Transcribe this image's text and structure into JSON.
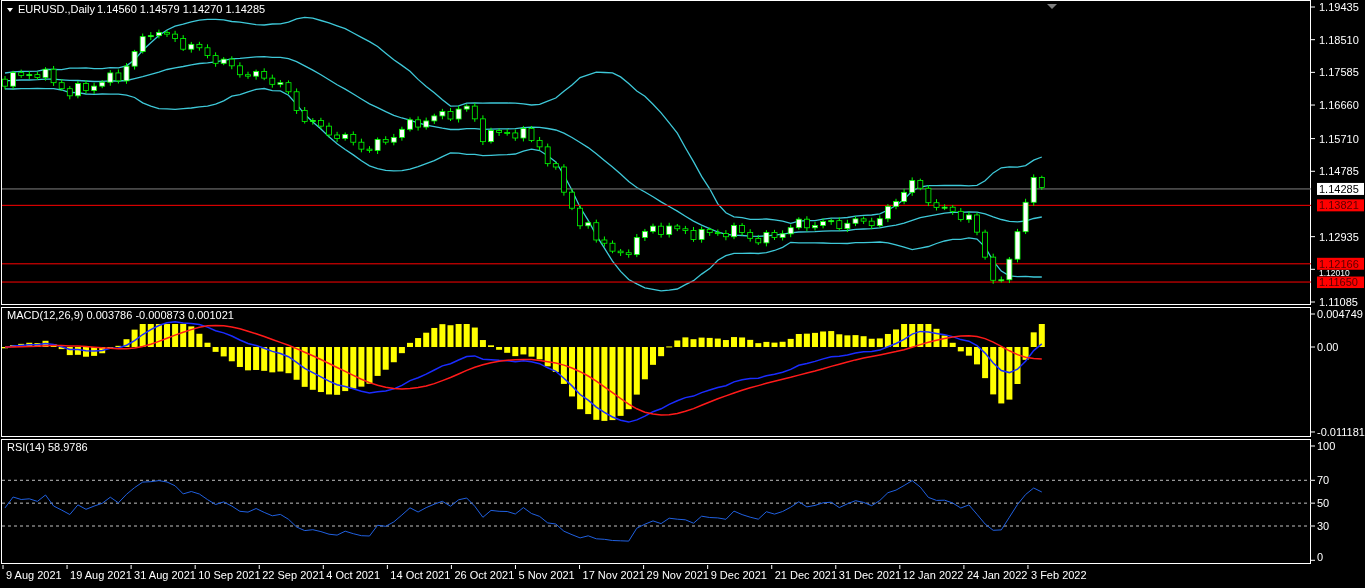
{
  "chart_header": {
    "symbol": "EURUSD.,Daily",
    "ohlc": "1.14560 1.14579 1.14270 1.14285"
  },
  "price_axis": {
    "labels": [
      "1.19435",
      "1.18510",
      "1.17585",
      "1.16660",
      "1.15710",
      "1.14785",
      "1.12935",
      "1.12010",
      "1.11085"
    ]
  },
  "price_tags": [
    {
      "text": "1.14285",
      "kind": "bid"
    },
    {
      "text": "1.13821",
      "kind": "level"
    },
    {
      "text": "1.12166",
      "kind": "level"
    },
    {
      "text": "1.11650",
      "kind": "level"
    }
  ],
  "macd": {
    "label": "MACD(12,26,9) 0.003786 -0.000873 0.001021",
    "axis": [
      "0.004749",
      "0.00",
      "-0.011181"
    ]
  },
  "rsi": {
    "label": "RSI(14) 58.9786",
    "axis": [
      "100",
      "70",
      "50",
      "30",
      "0"
    ]
  },
  "time_axis": [
    "9 Aug 2021",
    "19 Aug 2021",
    "31 Aug 2021",
    "10 Sep 2021",
    "22 Sep 2021",
    "4 Oct 2021",
    "14 Oct 2021",
    "26 Oct 2021",
    "5 Nov 2021",
    "17 Nov 2021",
    "29 Nov 2021",
    "9 Dec 2021",
    "21 Dec 2021",
    "31 Dec 2021",
    "12 Jan 2022",
    "24 Jan 2022",
    "3 Feb 2022"
  ]
}
